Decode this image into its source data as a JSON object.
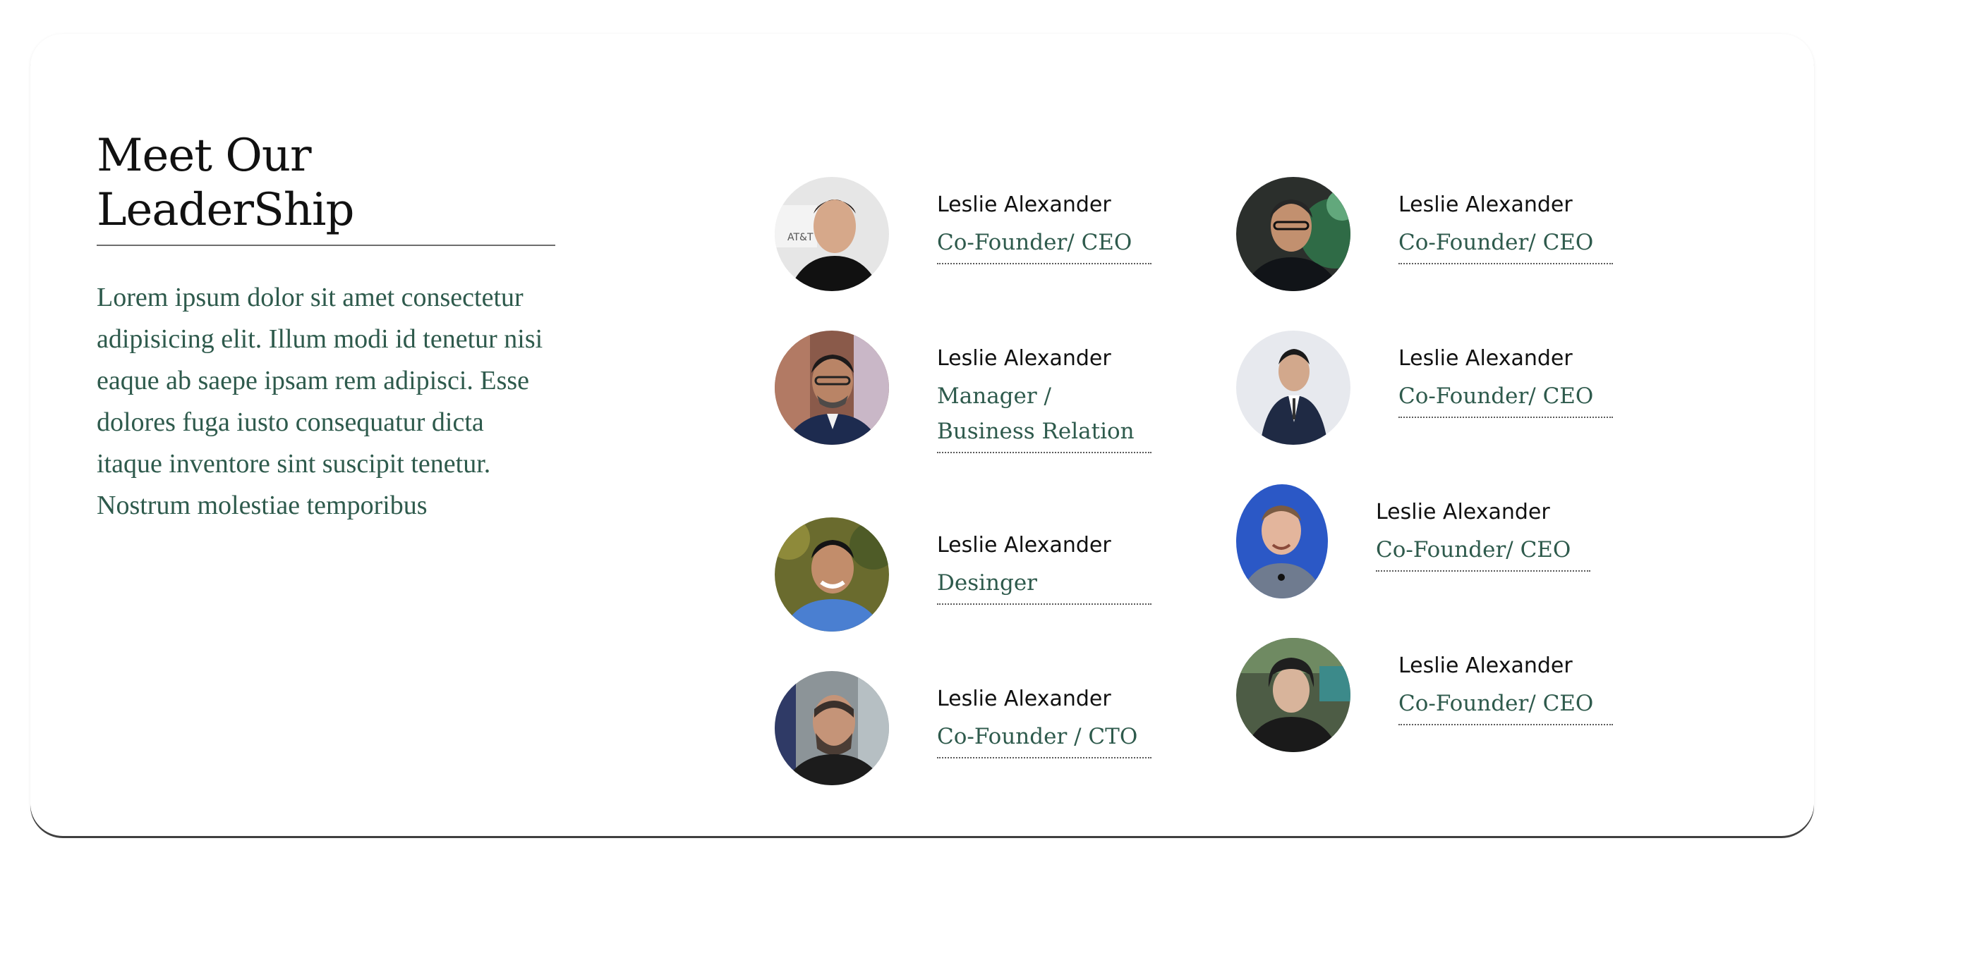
{
  "section": {
    "title": "Meet Our LeaderShip",
    "description": "Lorem ipsum dolor sit amet consectetur adipisicing elit. Illum modi id tenetur nisi eaque ab saepe ipsam rem adipisci. Esse dolores fuga iusto consequatur dicta itaque inventore sint suscipit tenetur. Nostrum molestiae temporibus"
  },
  "members": [
    {
      "name": "Leslie Alexander",
      "role": "Co-Founder/ CEO"
    },
    {
      "name": "Leslie Alexander",
      "role": "Manager / Business Relation"
    },
    {
      "name": "Leslie Alexander",
      "role": "Desinger"
    },
    {
      "name": "Leslie Alexander",
      "role": "Co-Founder / CTO"
    },
    {
      "name": "Leslie Alexander",
      "role": "Co-Founder/ CEO"
    },
    {
      "name": "Leslie Alexander",
      "role": "Co-Founder/ CEO"
    },
    {
      "name": "Leslie Alexander",
      "role": "Co-Founder/ CEO"
    },
    {
      "name": "Leslie Alexander",
      "role": "Co-Founder/ CEO"
    }
  ],
  "colors": {
    "heading": "#111111",
    "accent_green": "#2e5a4c",
    "card_border": "#3f3f3f"
  }
}
